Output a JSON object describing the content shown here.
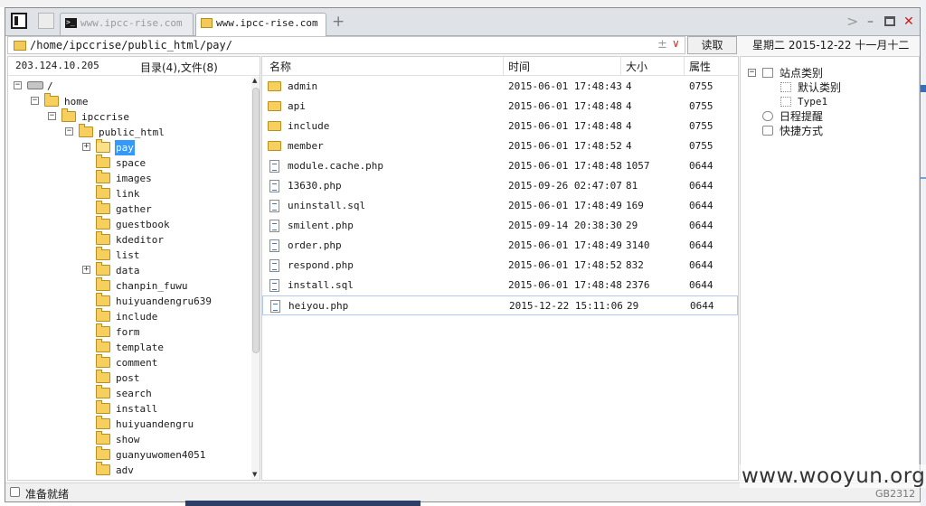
{
  "window": {
    "tabs": [
      {
        "label": "www.ipcc-rise.com",
        "active": false,
        "icon": "terminal-icon"
      },
      {
        "label": "www.ipcc-rise.com",
        "active": true,
        "icon": "folder-icon"
      }
    ],
    "add_tab": "+",
    "chevron": ">",
    "minimize": "–",
    "close": "✕"
  },
  "address": {
    "path": "/home/ipccrise/public_html/pay/",
    "plus_minus": "±",
    "dropdown": "∨",
    "read_button": "读取"
  },
  "datebar": {
    "text": "星期二 2015-12-22 十一月十二"
  },
  "left": {
    "ip": "203.124.10.205",
    "count": "目录(4),文件(8)",
    "tree": [
      {
        "label": "/",
        "level": 0,
        "exp": "−",
        "icon": "drive"
      },
      {
        "label": "home",
        "level": 1,
        "exp": "−",
        "icon": "folder"
      },
      {
        "label": "ipccrise",
        "level": 2,
        "exp": "−",
        "icon": "folder"
      },
      {
        "label": "public_html",
        "level": 3,
        "exp": "−",
        "icon": "folder"
      },
      {
        "label": "pay",
        "level": 4,
        "exp": "+",
        "icon": "folder-open",
        "selected": true
      },
      {
        "label": "space",
        "level": 4,
        "exp": "",
        "icon": "folder"
      },
      {
        "label": "images",
        "level": 4,
        "exp": "",
        "icon": "folder"
      },
      {
        "label": "link",
        "level": 4,
        "exp": "",
        "icon": "folder"
      },
      {
        "label": "gather",
        "level": 4,
        "exp": "",
        "icon": "folder"
      },
      {
        "label": "guestbook",
        "level": 4,
        "exp": "",
        "icon": "folder"
      },
      {
        "label": "kdeditor",
        "level": 4,
        "exp": "",
        "icon": "folder"
      },
      {
        "label": "list",
        "level": 4,
        "exp": "",
        "icon": "folder"
      },
      {
        "label": "data",
        "level": 4,
        "exp": "+",
        "icon": "folder"
      },
      {
        "label": "chanpin_fuwu",
        "level": 4,
        "exp": "",
        "icon": "folder"
      },
      {
        "label": "huiyuandengru639",
        "level": 4,
        "exp": "",
        "icon": "folder"
      },
      {
        "label": "include",
        "level": 4,
        "exp": "",
        "icon": "folder"
      },
      {
        "label": "form",
        "level": 4,
        "exp": "",
        "icon": "folder"
      },
      {
        "label": "template",
        "level": 4,
        "exp": "",
        "icon": "folder"
      },
      {
        "label": "comment",
        "level": 4,
        "exp": "",
        "icon": "folder"
      },
      {
        "label": "post",
        "level": 4,
        "exp": "",
        "icon": "folder"
      },
      {
        "label": "search",
        "level": 4,
        "exp": "",
        "icon": "folder"
      },
      {
        "label": "install",
        "level": 4,
        "exp": "",
        "icon": "folder"
      },
      {
        "label": "huiyuandengru",
        "level": 4,
        "exp": "",
        "icon": "folder"
      },
      {
        "label": "show",
        "level": 4,
        "exp": "",
        "icon": "folder"
      },
      {
        "label": "guanyuwomen4051",
        "level": 4,
        "exp": "",
        "icon": "folder"
      },
      {
        "label": "adv",
        "level": 4,
        "exp": "",
        "icon": "folder"
      }
    ]
  },
  "files": {
    "headers": {
      "name": "名称",
      "time": "时间",
      "size": "大小",
      "attr": "属性"
    },
    "rows": [
      {
        "name": "admin",
        "time": "2015-06-01 17:48:43",
        "size": "4",
        "attr": "0755",
        "type": "folder"
      },
      {
        "name": "api",
        "time": "2015-06-01 17:48:48",
        "size": "4",
        "attr": "0755",
        "type": "folder"
      },
      {
        "name": "include",
        "time": "2015-06-01 17:48:48",
        "size": "4",
        "attr": "0755",
        "type": "folder"
      },
      {
        "name": "member",
        "time": "2015-06-01 17:48:52",
        "size": "4",
        "attr": "0755",
        "type": "folder"
      },
      {
        "name": "module.cache.php",
        "time": "2015-06-01 17:48:48",
        "size": "1057",
        "attr": "0644",
        "type": "file"
      },
      {
        "name": "13630.php",
        "time": "2015-09-26 02:47:07",
        "size": "81",
        "attr": "0644",
        "type": "file"
      },
      {
        "name": "uninstall.sql",
        "time": "2015-06-01 17:48:49",
        "size": "169",
        "attr": "0644",
        "type": "file"
      },
      {
        "name": "smilent.php",
        "time": "2015-09-14 20:38:30",
        "size": "29",
        "attr": "0644",
        "type": "file"
      },
      {
        "name": "order.php",
        "time": "2015-06-01 17:48:49",
        "size": "3140",
        "attr": "0644",
        "type": "file"
      },
      {
        "name": "respond.php",
        "time": "2015-06-01 17:48:52",
        "size": "832",
        "attr": "0644",
        "type": "file"
      },
      {
        "name": "install.sql",
        "time": "2015-06-01 17:48:48",
        "size": "2376",
        "attr": "0644",
        "type": "file"
      },
      {
        "name": "heiyou.php",
        "time": "2015-12-22 15:11:06",
        "size": "29",
        "attr": "0644",
        "type": "file",
        "selected": true
      }
    ]
  },
  "right": {
    "items": [
      {
        "label": "站点类别",
        "level": 0,
        "exp": "−",
        "icon": "category-icon"
      },
      {
        "label": "默认类别",
        "level": 1,
        "exp": "",
        "icon": "dotted-box-icon"
      },
      {
        "label": "Type1",
        "level": 1,
        "exp": "",
        "icon": "dotted-box-icon"
      },
      {
        "label": "日程提醒",
        "level": 0,
        "exp": "",
        "icon": "reminder-icon"
      },
      {
        "label": "快捷方式",
        "level": 0,
        "exp": "",
        "icon": "shortcut-hand-icon"
      }
    ]
  },
  "status": {
    "text": "准备就绪",
    "encoding": "GB2312"
  },
  "watermark": "www.wooyun.org",
  "colors": {
    "selection": "#3399ff",
    "close": "#d01818",
    "folder": "#f6cf5e"
  }
}
